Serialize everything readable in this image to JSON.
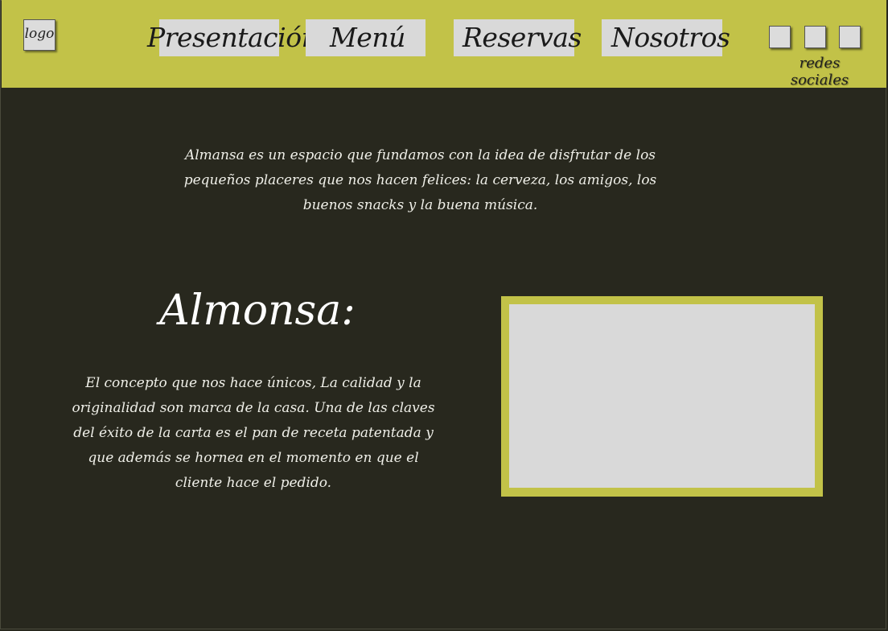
{
  "header": {
    "logo_text": "logo",
    "nav": [
      {
        "label": "Presentación"
      },
      {
        "label": "Menú"
      },
      {
        "label": "Reservas"
      },
      {
        "label": "Nosotros"
      }
    ],
    "social_label": "redes sociales"
  },
  "main": {
    "intro_text": "Almansa es un espacio que fundamos con la idea de disfrutar de los pequeños placeres que nos hacen felices: la cerveza, los amigos, los buenos snacks y la buena música.",
    "section_title": "Almonsa:",
    "concept_text": "El concepto que nos hace únicos, La calidad y la originalidad son marca de la casa. Una de las claves del éxito de la carta es el pan de receta patentada y que además se hornea en el momento en que el cliente hace el pedido."
  },
  "colors": {
    "accent": "#c2c248",
    "background": "#28281e",
    "placeholder": "#d9d9d9"
  }
}
